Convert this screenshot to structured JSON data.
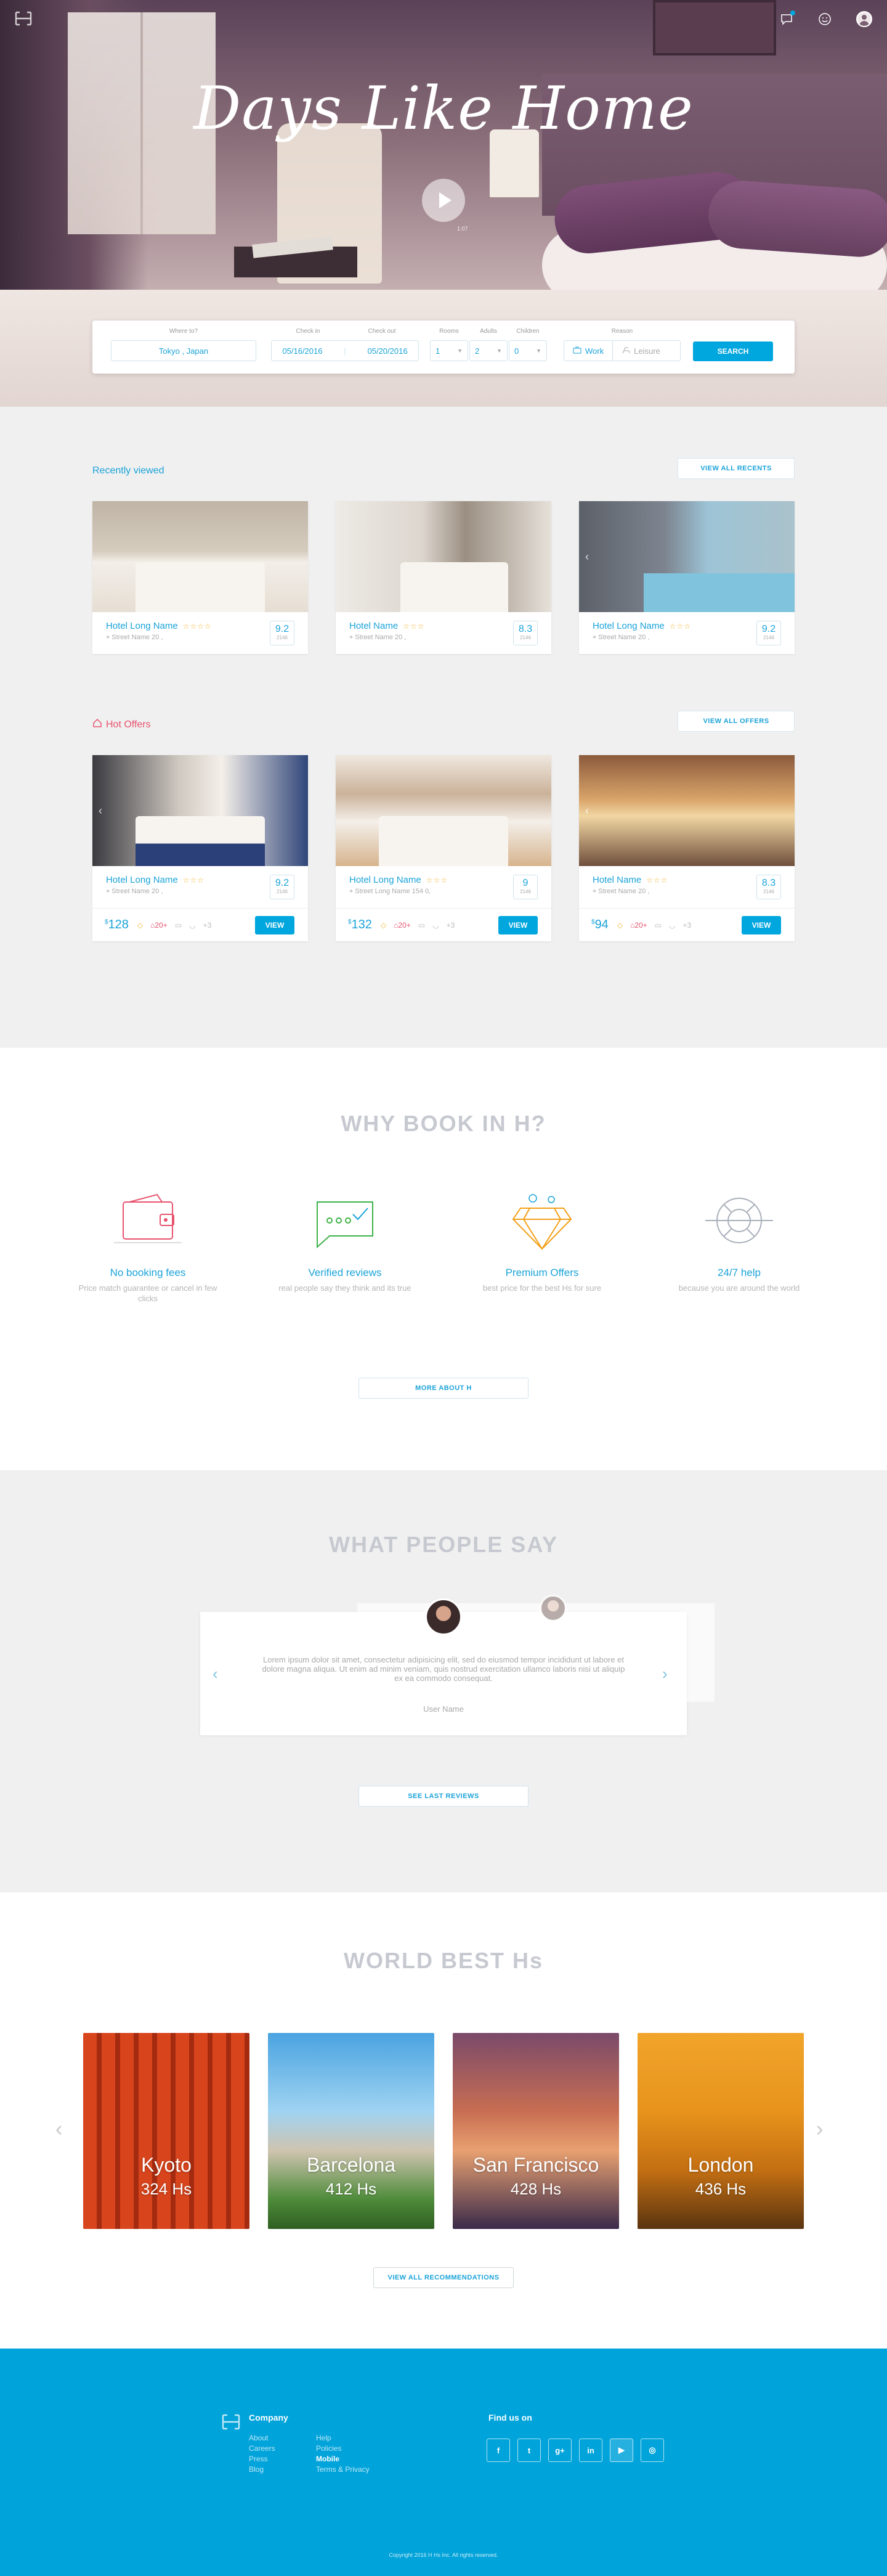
{
  "hero": {
    "title": "Days Like Home",
    "video_time": "1:07",
    "search": {
      "where_label": "Where to?",
      "where_value": "Tokyo , Japan",
      "checkin_label": "Check in",
      "checkin_value": "05/16/2016",
      "checkout_label": "Check out",
      "checkout_value": "05/20/2016",
      "rooms_label": "Rooms",
      "rooms_value": "1",
      "adults_label": "Adults",
      "adults_value": "2",
      "children_label": "Children",
      "children_value": "0",
      "reason_label": "Reason",
      "reason_options": [
        "Work",
        "Leisure"
      ],
      "reason_selected": "Work",
      "search_button": "SEARCH"
    }
  },
  "recently_viewed": {
    "title": "Recently viewed",
    "view_all": "VIEW ALL  RECENTS",
    "cards": [
      {
        "name": "Hotel Long Name",
        "stars": "☆☆☆☆",
        "address": "Street Name 20 ,",
        "score": "9.2",
        "reviews": "2146"
      },
      {
        "name": "Hotel Name",
        "stars": "☆☆☆",
        "address": "Street Name 20 ,",
        "score": "8.3",
        "reviews": "2146"
      },
      {
        "name": "Hotel Long Name",
        "stars": "☆☆☆",
        "address": "Street Name 20 ,",
        "score": "9.2",
        "reviews": "2146"
      }
    ]
  },
  "hot_offers": {
    "title": "Hot Offers",
    "view_all": "VIEW ALL  OFFERS",
    "cards": [
      {
        "name": "Hotel Long Name",
        "stars": "☆☆☆",
        "address": "Street Name 20 ,",
        "score": "9.2",
        "reviews": "2146",
        "price": "128",
        "discount": "20+",
        "extra": "+3",
        "button": "VIEW"
      },
      {
        "name": "Hotel Long Name",
        "stars": "☆☆☆",
        "address": "Street Long Name 154 0,",
        "score": "9",
        "reviews": "2146",
        "price": "132",
        "discount": "20+",
        "extra": "+3",
        "button": "VIEW"
      },
      {
        "name": "Hotel Name",
        "stars": "☆☆☆",
        "address": "Street Name 20 ,",
        "score": "8.3",
        "reviews": "2146",
        "price": "94",
        "discount": "20+",
        "extra": "+3",
        "button": "VIEW"
      }
    ]
  },
  "why": {
    "title": "WHY BOOK IN H?",
    "features": [
      {
        "title": "No booking fees",
        "desc": "Price match guarantee or cancel in few clicks",
        "icon": "wallet-icon"
      },
      {
        "title": "Verified reviews",
        "desc": "real people say they think and its true",
        "icon": "chat-check-icon"
      },
      {
        "title": "Premium Offers",
        "desc": "best price for the best Hs for sure",
        "icon": "diamond-icon"
      },
      {
        "title": "24/7 help",
        "desc": "because you are around the world",
        "icon": "lifebuoy-icon"
      }
    ],
    "more_button": "MORE ABOUT H"
  },
  "reviews": {
    "title": "WHAT PEOPLE SAY",
    "text": "Lorem ipsum dolor sit amet, consectetur adipisicing elit, sed do eiusmod tempor incididunt ut labore et dolore magna aliqua. Ut enim ad minim veniam, quis nostrud exercitation ullamco laboris nisi ut aliquip ex ea commodo consequat.",
    "user": "User Name",
    "button": "SEE LAST REVIEWS"
  },
  "world": {
    "title": "WORLD BEST Hs",
    "cities": [
      {
        "name": "Kyoto",
        "count": "324 Hs"
      },
      {
        "name": "Barcelona",
        "count": "412 Hs"
      },
      {
        "name": "San Francisco",
        "count": "428 Hs"
      },
      {
        "name": "London",
        "count": "436 Hs"
      }
    ],
    "button": "VIEW ALL  RECOMMENDATIONS"
  },
  "footer": {
    "company_title": "Company",
    "col1": [
      "About",
      "Careers",
      "Press",
      "Blog"
    ],
    "col2": [
      "Help",
      "Policies",
      "Mobile",
      "Terms & Privacy"
    ],
    "find_us": "Find us on",
    "social": [
      "f",
      "t",
      "g+",
      "in",
      "▶",
      "◎"
    ],
    "copyright": "Copyright 2016 H Hs Inc. All rights reserved."
  },
  "colors": {
    "accent": "#00a6de",
    "hot": "#e8536e",
    "star": "#f3b530"
  }
}
